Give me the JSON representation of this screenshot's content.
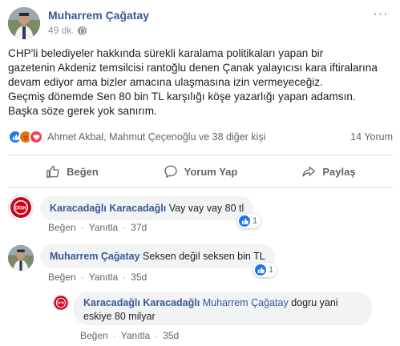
{
  "post": {
    "author": "Muharrem Çağatay",
    "time": "49 dk.",
    "more_label": "···",
    "lines": [
      "CHP'li belediyeler hakkında sürekli karalama politikaları yapan bir",
      "gazetenin Akdeniz temsilcisi rantoğlu denen Çanak yalayıcısı kara iftiralarına",
      "devam ediyor ama bizler amacına ulaşmasına izin vermeyeceğiz.",
      "Geçmiş dönemde Sen 80 bin TL karşılığı köşe yazarlığı yapan adamsın.",
      "Başka söze gerek yok sanırım."
    ]
  },
  "reactions": {
    "names": "Ahmet Akbal, Mahmut Çeçenoğlu ve 38 diğer kişi",
    "comment_count": "14 Yorum",
    "icons": [
      "like-icon",
      "angry-icon",
      "love-icon"
    ],
    "colors": {
      "like": "#1877f2",
      "angry": "#e9710f",
      "love": "#f33e58"
    }
  },
  "actions": {
    "like": "Beğen",
    "comment": "Yorum Yap",
    "share": "Paylaş"
  },
  "comments": [
    {
      "author": "Karacadağlı Karacadağlı",
      "text": "Vay vay vay 80 tl",
      "like_count": "1",
      "like_label": "Beğen",
      "reply_label": "Yanıtla",
      "time": "37d",
      "avatar_text": "DİSK"
    },
    {
      "author": "Muharrem Çağatay",
      "text": "Seksen değil seksen bin TL",
      "like_count": "1",
      "like_label": "Beğen",
      "reply_label": "Yanıtla",
      "time": "35d"
    },
    {
      "author": "Karacadağlı Karacadağlı",
      "mention": "Muharrem Çağatay",
      "text_line1": "dogru yani",
      "text_line2": "eskiye 80 milyar",
      "like_label": "Beğen",
      "reply_label": "Yanıtla",
      "time": "35d",
      "avatar_text": "DİSK"
    }
  ],
  "brand_color": "#385898"
}
